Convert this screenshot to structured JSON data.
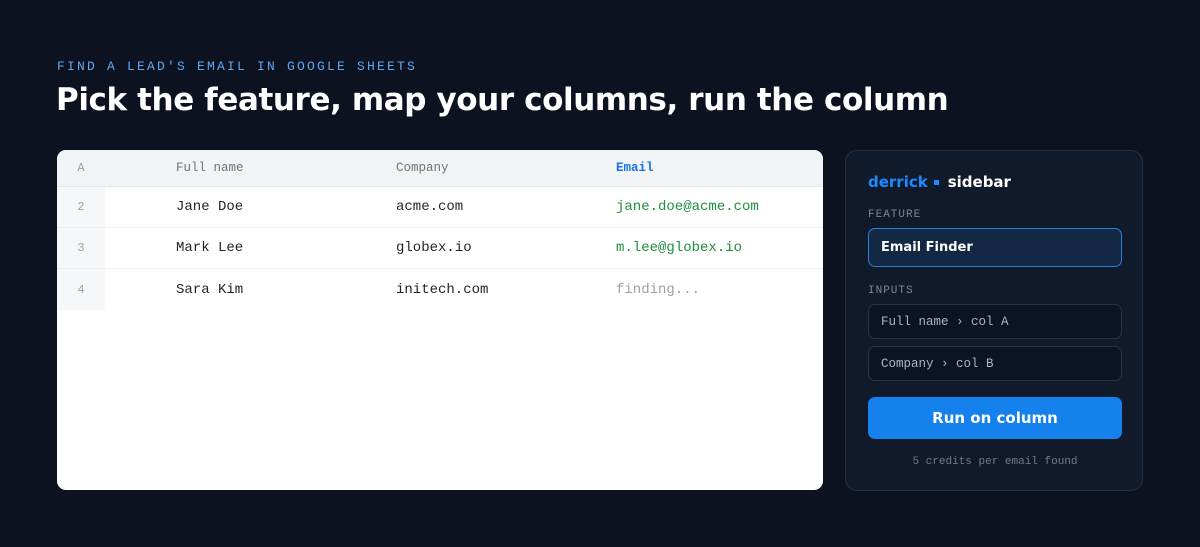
{
  "eyebrow": "FIND A LEAD'S EMAIL IN GOOGLE SHEETS",
  "headline": "Pick the feature, map your columns, run the column",
  "sheet": {
    "header": {
      "rownum": "A",
      "full_name": "Full name",
      "company": "Company",
      "email": "Email"
    },
    "rows": [
      {
        "rownum": "2",
        "full_name": "Jane Doe",
        "company": "acme.com",
        "email": "jane.doe@acme.com",
        "status": "found"
      },
      {
        "rownum": "3",
        "full_name": "Mark Lee",
        "company": "globex.io",
        "email": "m.lee@globex.io",
        "status": "found"
      },
      {
        "rownum": "4",
        "full_name": "Sara Kim",
        "company": "initech.com",
        "email": "finding...",
        "status": "pending"
      }
    ]
  },
  "sidebar": {
    "brand": "derrick",
    "brand_suffix": "sidebar",
    "feature_label": "FEATURE",
    "feature_value": "Email Finder",
    "inputs_label": "INPUTS",
    "inputs": [
      {
        "text": "Full name › col A"
      },
      {
        "text": "Company › col B"
      }
    ],
    "run_button": "Run on column",
    "credits_note": "5 credits per email found"
  },
  "colors": {
    "background": "#0c1220",
    "accent": "#1481ec",
    "found_email": "#1e8e3e",
    "eyebrow": "#5fa8f0"
  }
}
